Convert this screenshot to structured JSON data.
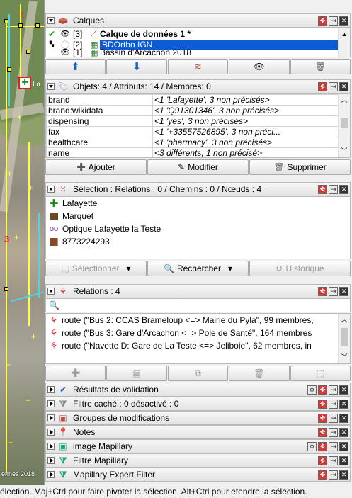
{
  "map": {
    "selected_label": "La",
    "watermark": "ennes 2018"
  },
  "layers": {
    "title": "Calques",
    "rows": [
      {
        "index": "[3]",
        "name": "Calque de données 1 *"
      },
      {
        "index": "[2]",
        "name": "BDOrtho IGN"
      },
      {
        "index": "[1]",
        "name": "Bassin d'Arcachon 2018"
      }
    ]
  },
  "tags": {
    "title": "Objets: 4 / Attributs: 14 / Membres: 0",
    "rows": [
      {
        "key": "brand",
        "value": "<1 'Lafayette', 3 non précisés>"
      },
      {
        "key": "brand:wikidata",
        "value": "<1 'Q91301346', 3 non précisés>"
      },
      {
        "key": "dispensing",
        "value": "<1 'yes', 3 non précisés>"
      },
      {
        "key": "fax",
        "value": "<1 '+33557526895', 3 non préci..."
      },
      {
        "key": "healthcare",
        "value": "<1 'pharmacy', 3 non précisés>"
      },
      {
        "key": "name",
        "value": "<3 différents, 1 non précisé>"
      }
    ],
    "buttons": {
      "add": "Ajouter",
      "edit": "Modifier",
      "delete": "Supprimer"
    }
  },
  "selection": {
    "title": "Sélection : Relations : 0 / Chemins : 0 / Nœuds : 4",
    "items": [
      "Lafayette",
      "Marquet",
      "Optique Lafayette la Teste",
      "8773224293"
    ],
    "buttons": {
      "select": "Sélectionner",
      "search": "Rechercher",
      "history": "Historique"
    }
  },
  "relations": {
    "title": "Relations : 4",
    "search_placeholder": "",
    "rows": [
      "route (\"Bus 2: CCAS Brameloup <=> Mairie du Pyla\", 99 membres,",
      "route (\"Bus 3: Gare d'Arcachon <=> Pole de Santé\", 164 membres",
      "route (\"Navette D: Gare de La Teste <=> Jeliboie\", 62 membres, in"
    ]
  },
  "collapsed_panels": [
    "Résultats de validation",
    "Filtre caché : 0 désactivé : 0",
    "Groupes de modifications",
    "Notes",
    "image Mapillary",
    "Filtre Mapillary",
    "Mapillary Expert Filter"
  ],
  "status": "élection. Maj+Ctrl pour faire pivoter la sélection. Alt+Ctrl pour étendre la sélection.",
  "colors": {
    "accent": "#0d5bd6",
    "highlight": "#d53a3a",
    "green_cross": "#1a8a1a"
  }
}
